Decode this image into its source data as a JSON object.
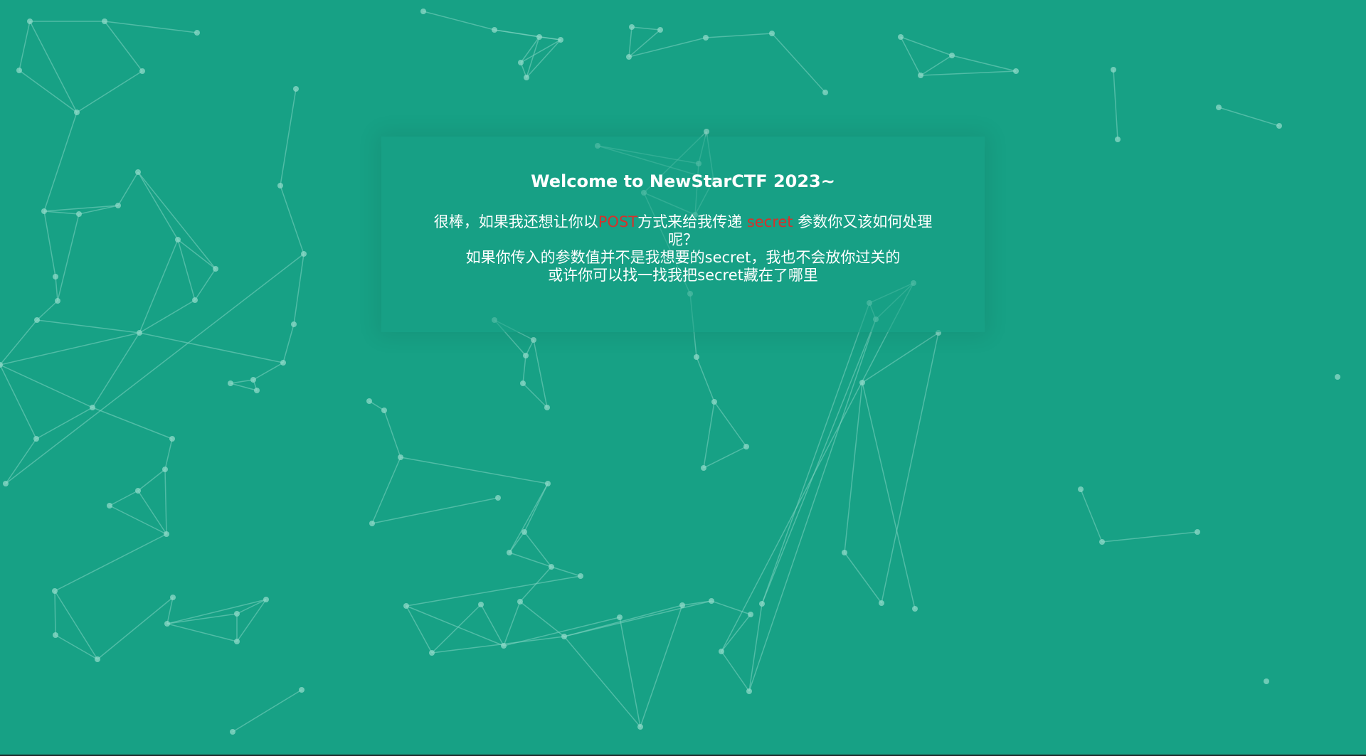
{
  "page": {
    "title": "Welcome to NewStarCTF 2023~",
    "message": {
      "line1_part1": "很棒，如果我还想让你以",
      "line1_method": "POST",
      "line1_part2": "方式来给我传递 ",
      "line1_param": "secret",
      "line1_part3": " 参数你又该如何处理呢？",
      "line2": "如果你传入的参数值并不是我想要的secret，我也不会放你过关的",
      "line3": "或许你可以找一找我把secret藏在了哪里"
    }
  },
  "colors": {
    "background": "#17a185",
    "text": "#ffffff",
    "highlight": "#d6312b",
    "network": "#7fd3c1"
  },
  "background_decoration": "particle-network"
}
